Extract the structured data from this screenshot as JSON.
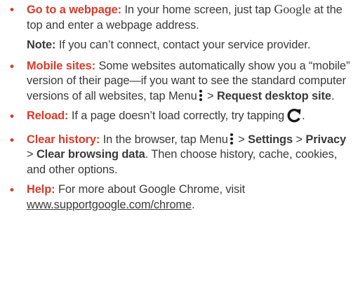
{
  "items": {
    "webpage": {
      "bullet": "•",
      "heading": "Go to a webpage:",
      "text1": " In your home screen, just tap ",
      "google_word": "Google",
      "text2": " at the top and enter a webpage address."
    },
    "note": {
      "label": "Note:",
      "text": " If you can’t connect, contact your service provider."
    },
    "mobile": {
      "bullet": "•",
      "heading": "Mobile sites:",
      "text1": " Some websites automatically show you a “mobile” version of their page—if you want to see the standard computer versions of all websites, tap Menu",
      "sep": " > ",
      "bold1": "Request desktop site",
      "end": "."
    },
    "reload": {
      "bullet": "•",
      "heading": "Reload:",
      "text1": " If a page doesn’t load correctly, try tapping",
      "end": "."
    },
    "history": {
      "bullet": "•",
      "heading": "Clear history:",
      "text1": " In the browser, tap Menu",
      "sep1": " > ",
      "bold1": "Settings",
      "sep2": " > ",
      "bold2": "Privacy",
      "sep3": " > ",
      "bold3": "Clear browsing data",
      "text2": ". Then choose history, cache, cookies, and other options."
    },
    "help": {
      "bullet": "•",
      "heading": "Help:",
      "text1": " For more about Google Chrome, visit ",
      "link": "www.supportgoogle.com/chrome",
      "end": "."
    }
  },
  "icons": {
    "menu": "menu-icon",
    "reload": "reload-icon"
  },
  "colors": {
    "accent": "#d63b2a",
    "text": "#3a3a3a",
    "icon": "#1a1a1a"
  }
}
